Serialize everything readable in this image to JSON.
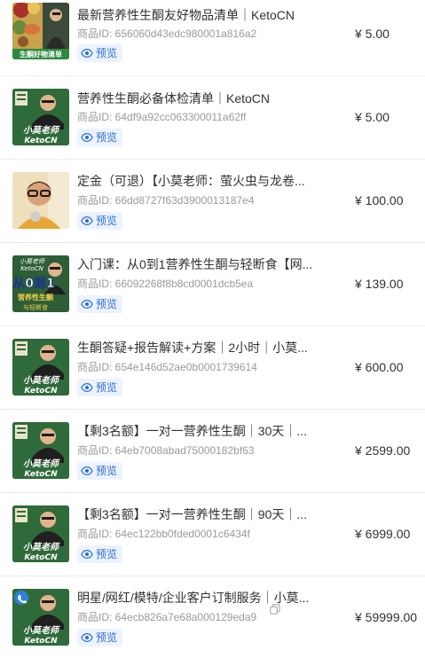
{
  "products": [
    {
      "title": "最新营养性生酮友好物品清单｜KetoCN",
      "id_label": "商品ID: 656060d43edc980001a816a2",
      "preview_label": "预览",
      "price": "¥ 5.00",
      "thumb": "food-collage",
      "thumb_caption": "生酮好物清单"
    },
    {
      "title": "营养性生酮必备体检清单｜KetoCN",
      "id_label": "商品ID: 64df9a92cc063300011a62ff",
      "preview_label": "预览",
      "price": "¥ 5.00",
      "thumb": "teacher-poster",
      "thumb_caption": "小莫老师 KetoCN"
    },
    {
      "title": "定金（可退）【小莫老师：萤火虫与龙卷...",
      "id_label": "商品ID: 66dd8727f63d3900013187e4",
      "preview_label": "预览",
      "price": "¥ 100.00",
      "thumb": "portrait-photo",
      "thumb_caption": ""
    },
    {
      "title": "入门课：从0到1营养性生酮与轻断食【网...",
      "id_label": "商品ID: 66092268f8b8cd0001dcb5ea",
      "preview_label": "预览",
      "price": "¥ 139.00",
      "thumb": "course-poster",
      "thumb_caption": "从0到1 营养性生酮"
    },
    {
      "title": "生酮答疑+报告解读+方案｜2小时｜小莫...",
      "id_label": "商品ID: 654e146d52ae0b0001739614",
      "preview_label": "预览",
      "price": "¥ 600.00",
      "thumb": "teacher-poster",
      "thumb_caption": "小莫老师 KetoCN"
    },
    {
      "title": "【剩3名额】一对一营养性生酮｜30天｜...",
      "id_label": "商品ID: 64eb7008abad75000182bf63",
      "preview_label": "预览",
      "price": "¥ 2599.00",
      "thumb": "teacher-poster",
      "thumb_caption": "小莫老师 KetoCN"
    },
    {
      "title": "【剩3名额】一对一营养性生酮｜90天｜...",
      "id_label": "商品ID: 64ec122bb0fded0001c6434f",
      "preview_label": "预览",
      "price": "¥ 6999.00",
      "thumb": "teacher-poster",
      "thumb_caption": "小莫老师 KetoCN"
    },
    {
      "title": "明星/网红/模特/企业客户订制服务｜小莫...",
      "id_label": "商品ID: 64ecb826a7e68a000129eda9",
      "preview_label": "预览",
      "price": "¥ 59999.00",
      "thumb": "teacher-poster-phone",
      "thumb_caption": "小莫老师 KetoCN",
      "show_copy_icon": true
    }
  ],
  "colors": {
    "accent_blue": "#2b6fd6",
    "preview_bg": "#ecf3ff",
    "poster_green": "#2f6b3a",
    "muted_text": "#9a9a9a"
  }
}
